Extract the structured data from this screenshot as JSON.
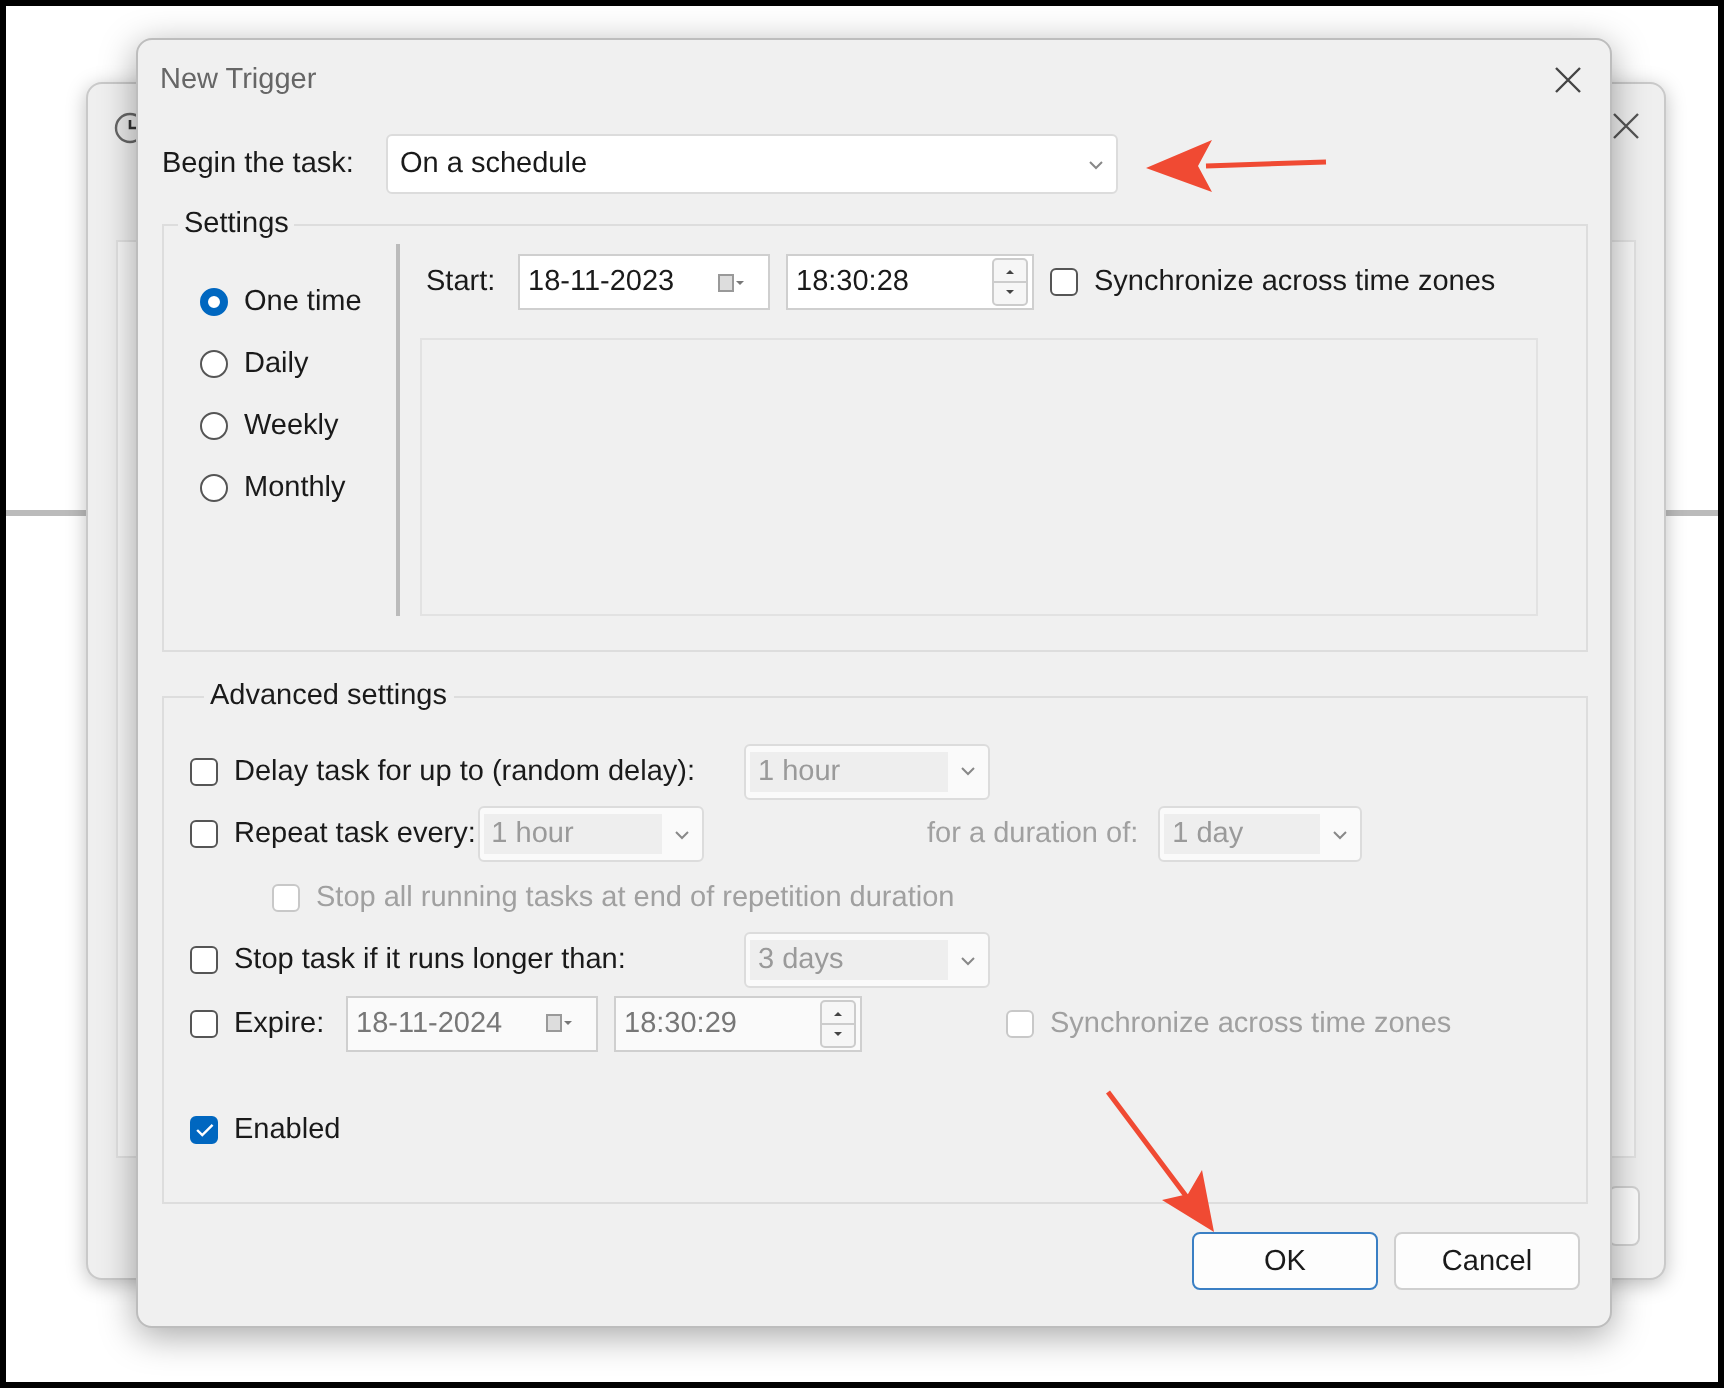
{
  "window": {
    "title": "New Trigger"
  },
  "begin": {
    "label": "Begin the task:",
    "value": "On a schedule"
  },
  "settings": {
    "title": "Settings",
    "schedule": [
      {
        "label": "One time",
        "selected": true
      },
      {
        "label": "Daily",
        "selected": false
      },
      {
        "label": "Weekly",
        "selected": false
      },
      {
        "label": "Monthly",
        "selected": false
      }
    ],
    "start": {
      "label": "Start:",
      "date": "18-11-2023",
      "time": "18:30:28",
      "sync": {
        "label": "Synchronize across time zones",
        "checked": false
      }
    }
  },
  "advanced": {
    "title": "Advanced settings",
    "options": [
      {
        "kind": "delay",
        "label": "Delay task for up to (random delay):",
        "checked": false,
        "disabled": false,
        "value": "1 hour"
      },
      {
        "kind": "repeat",
        "label": "Repeat task every:",
        "checked": false,
        "disabled": false,
        "value": "1 hour",
        "duration_label": "for a duration of:",
        "duration": "1 day"
      },
      {
        "kind": "stop_all",
        "label": "Stop all running tasks at end of repetition duration",
        "checked": false,
        "disabled": true
      },
      {
        "kind": "stop",
        "label": "Stop task if it runs longer than:",
        "checked": false,
        "disabled": false,
        "value": "3 days"
      },
      {
        "kind": "expire",
        "label": "Expire:",
        "checked": false,
        "disabled": false,
        "date": "18-11-2024",
        "time": "18:30:29",
        "sync": {
          "label": "Synchronize across time zones",
          "checked": false
        }
      },
      {
        "kind": "enabled",
        "label": "Enabled",
        "checked": true,
        "disabled": false
      }
    ]
  },
  "buttons": [
    {
      "label": "OK",
      "default": true
    },
    {
      "label": "Cancel",
      "default": false
    }
  ],
  "annotations": [
    {
      "kind": "arrow_left"
    },
    {
      "kind": "arrow_down_right"
    }
  ]
}
